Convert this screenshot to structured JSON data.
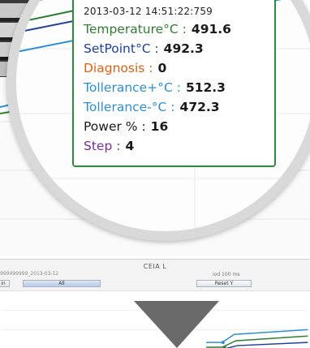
{
  "tooltip": {
    "timestamp": "2013-03-12 14:51:22:759",
    "rows": [
      {
        "label": "Temperature°C :",
        "value": "491.6",
        "color": "#2e7d32"
      },
      {
        "label": "SetPoint°C :",
        "value": "492.3",
        "color": "#1f3f9a"
      },
      {
        "label": "Diagnosis :",
        "value": "0",
        "color": "#e06010"
      },
      {
        "label": "Tollerance+°C :",
        "value": "512.3",
        "color": "#2a8fd6"
      },
      {
        "label": "Tollerance-°C :",
        "value": "472.3",
        "color": "#2a8fd6"
      },
      {
        "label": "Power % :",
        "value": "16",
        "color": "#1a1a1a"
      },
      {
        "label": "Step :",
        "value": "4",
        "color": "#7b2d9b"
      }
    ]
  },
  "app": {
    "title": "CEIA L",
    "file_name": "999999999_2013-03-12",
    "period": "iod 100 ms",
    "buttons": {
      "min": "in",
      "all": "All",
      "reset_y": "Reset Y"
    }
  },
  "colors": {
    "temperature_line": "#2e7d32",
    "tolerance_line": "#2a8fd6",
    "setpoint_line": "#1f3f9a"
  },
  "icons": {
    "zoom_arrow": "arrow-down-icon"
  }
}
